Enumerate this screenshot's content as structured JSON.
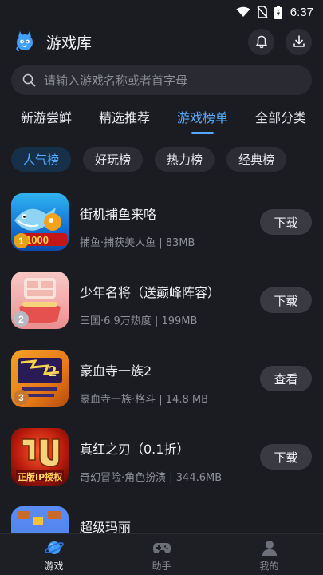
{
  "status_bar": {
    "time": "6:37"
  },
  "header": {
    "title": "游戏库",
    "logo_icon": "mascot-logo-icon",
    "bell_icon": "bell-icon",
    "download_icon": "download-icon"
  },
  "search": {
    "placeholder": "请输入游戏名称或者首字母",
    "icon": "search-icon"
  },
  "tabs": [
    {
      "label": "新游尝鲜",
      "active": false
    },
    {
      "label": "精选推荐",
      "active": false
    },
    {
      "label": "游戏榜单",
      "active": true
    },
    {
      "label": "全部分类",
      "active": false
    }
  ],
  "chips": [
    {
      "label": "人气榜",
      "active": true
    },
    {
      "label": "好玩榜",
      "active": false
    },
    {
      "label": "热力榜",
      "active": false
    },
    {
      "label": "经典榜",
      "active": false
    }
  ],
  "games": [
    {
      "rank": "1",
      "name": "街机捕鱼来咯",
      "meta": "捕鱼·捕获美人鱼 | 83MB",
      "action": "下载",
      "rank_color": "#e7a118"
    },
    {
      "rank": "2",
      "name": "少年名将（送巅峰阵容）",
      "meta": "三国·6.9万热度 | 199MB",
      "action": "下载",
      "rank_color": "#b7bac2"
    },
    {
      "rank": "3",
      "name": "豪血寺一族2",
      "meta": "豪血寺一族·格斗 | 14.8 MB",
      "action": "查看",
      "rank_color": "#c9772f"
    },
    {
      "rank": "",
      "name": "真红之刃（0.1折）",
      "meta": "奇幻冒险·角色扮演 | 344.6MB",
      "action": "下载",
      "rank_color": ""
    },
    {
      "rank": "",
      "name": "超级玛丽",
      "meta": "",
      "action": "",
      "rank_color": ""
    }
  ],
  "icon_art": {
    "1": {
      "text": "1000"
    },
    "3": {
      "text": "2"
    },
    "4": {
      "text": "正版IP授权"
    }
  },
  "bottom_nav": [
    {
      "label": "游戏",
      "icon": "planet-icon",
      "active": true
    },
    {
      "label": "助手",
      "icon": "gamepad-icon",
      "active": false
    },
    {
      "label": "我的",
      "icon": "user-icon",
      "active": false
    }
  ],
  "colors": {
    "accent": "#56a8ff",
    "background": "#1b1c22",
    "chip_active_bg": "#17304a"
  }
}
